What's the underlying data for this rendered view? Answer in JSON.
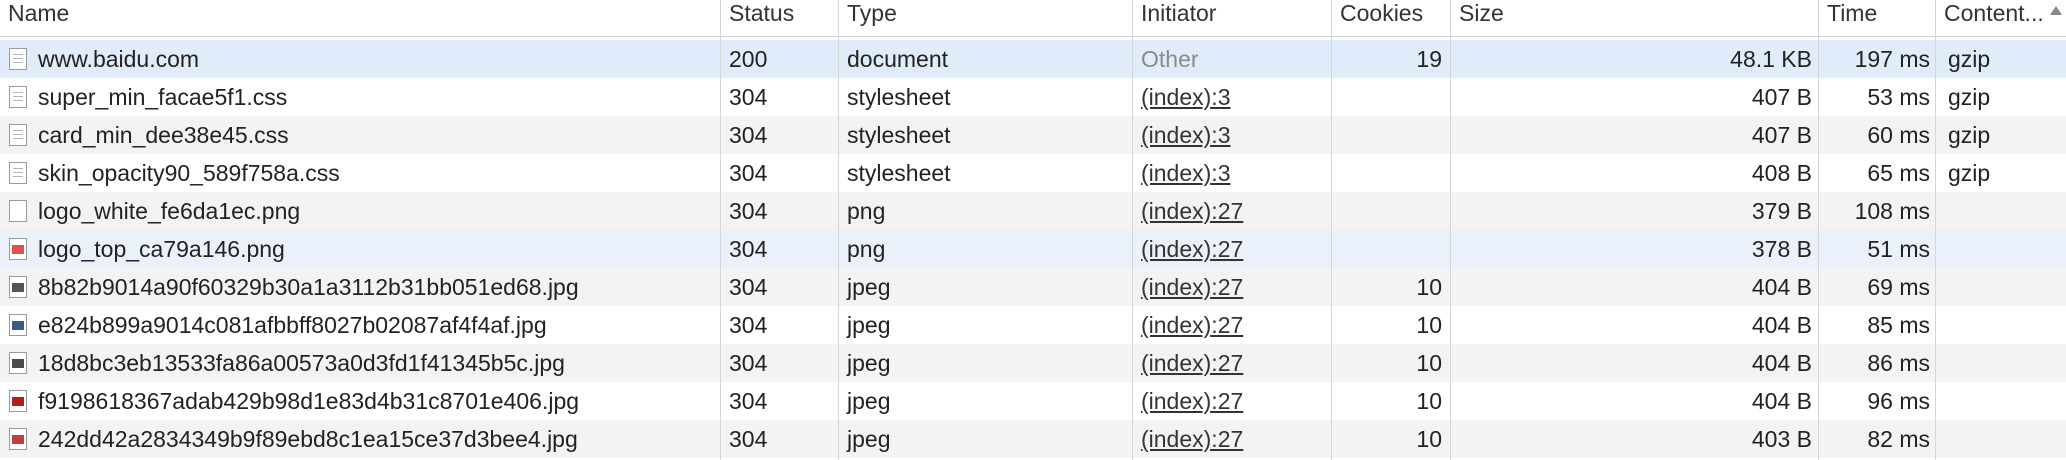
{
  "columns": {
    "name": "Name",
    "status": "Status",
    "type": "Type",
    "initiator": "Initiator",
    "cookies": "Cookies",
    "size": "Size",
    "time": "Time",
    "content": "Content..."
  },
  "rows": [
    {
      "name": "www.baidu.com",
      "status": "200",
      "type": "document",
      "initiator": "Other",
      "cookies": "19",
      "size": "48.1 KB",
      "time": "197 ms",
      "encoding": "gzip",
      "icon": "document-icon",
      "icon_color": "#ffffff"
    },
    {
      "name": "super_min_facae5f1.css",
      "status": "304",
      "type": "stylesheet",
      "initiator": "(index):3",
      "cookies": "",
      "size": "407 B",
      "time": "53 ms",
      "encoding": "gzip",
      "icon": "stylesheet-file-icon",
      "icon_color": "#ffffff"
    },
    {
      "name": "card_min_dee38e45.css",
      "status": "304",
      "type": "stylesheet",
      "initiator": "(index):3",
      "cookies": "",
      "size": "407 B",
      "time": "60 ms",
      "encoding": "gzip",
      "icon": "stylesheet-file-icon",
      "icon_color": "#ffffff"
    },
    {
      "name": "skin_opacity90_589f758a.css",
      "status": "304",
      "type": "stylesheet",
      "initiator": "(index):3",
      "cookies": "",
      "size": "408 B",
      "time": "65 ms",
      "encoding": "gzip",
      "icon": "stylesheet-file-icon",
      "icon_color": "#ffffff"
    },
    {
      "name": "logo_white_fe6da1ec.png",
      "status": "304",
      "type": "png",
      "initiator": "(index):27",
      "cookies": "",
      "size": "379 B",
      "time": "108 ms",
      "encoding": "",
      "icon": "image-thumbnail-icon",
      "icon_color": "#ffffff"
    },
    {
      "name": "logo_top_ca79a146.png",
      "status": "304",
      "type": "png",
      "initiator": "(index):27",
      "cookies": "",
      "size": "378 B",
      "time": "51 ms",
      "encoding": "",
      "icon": "image-thumbnail-icon",
      "icon_color": "#e05050"
    },
    {
      "name": "8b82b9014a90f60329b30a1a3112b31bb051ed68.jpg",
      "status": "304",
      "type": "jpeg",
      "initiator": "(index):27",
      "cookies": "10",
      "size": "404 B",
      "time": "69 ms",
      "encoding": "",
      "icon": "image-thumbnail-icon",
      "icon_color": "#555555"
    },
    {
      "name": "e824b899a9014c081afbbff8027b02087af4f4af.jpg",
      "status": "304",
      "type": "jpeg",
      "initiator": "(index):27",
      "cookies": "10",
      "size": "404 B",
      "time": "85 ms",
      "encoding": "",
      "icon": "image-thumbnail-icon",
      "icon_color": "#3a5a8a"
    },
    {
      "name": "18d8bc3eb13533fa86a00573a0d3fd1f41345b5c.jpg",
      "status": "304",
      "type": "jpeg",
      "initiator": "(index):27",
      "cookies": "10",
      "size": "404 B",
      "time": "86 ms",
      "encoding": "",
      "icon": "image-thumbnail-icon",
      "icon_color": "#4a4a4a"
    },
    {
      "name": "f9198618367adab429b98d1e83d4b31c8701e406.jpg",
      "status": "304",
      "type": "jpeg",
      "initiator": "(index):27",
      "cookies": "10",
      "size": "404 B",
      "time": "96 ms",
      "encoding": "",
      "icon": "image-thumbnail-icon",
      "icon_color": "#b02020"
    },
    {
      "name": "242dd42a2834349b9f89ebd8c1ea15ce37d3bee4.jpg",
      "status": "304",
      "type": "jpeg",
      "initiator": "(index):27",
      "cookies": "10",
      "size": "403 B",
      "time": "82 ms",
      "encoding": "",
      "icon": "image-thumbnail-icon",
      "icon_color": "#c04040"
    }
  ],
  "colors": {
    "selected_row": "#e1ecfa",
    "hover_row": "#ebf1fa",
    "stripe_row": "#f3f3f3",
    "muted_initiator": "#8a8a8a"
  }
}
